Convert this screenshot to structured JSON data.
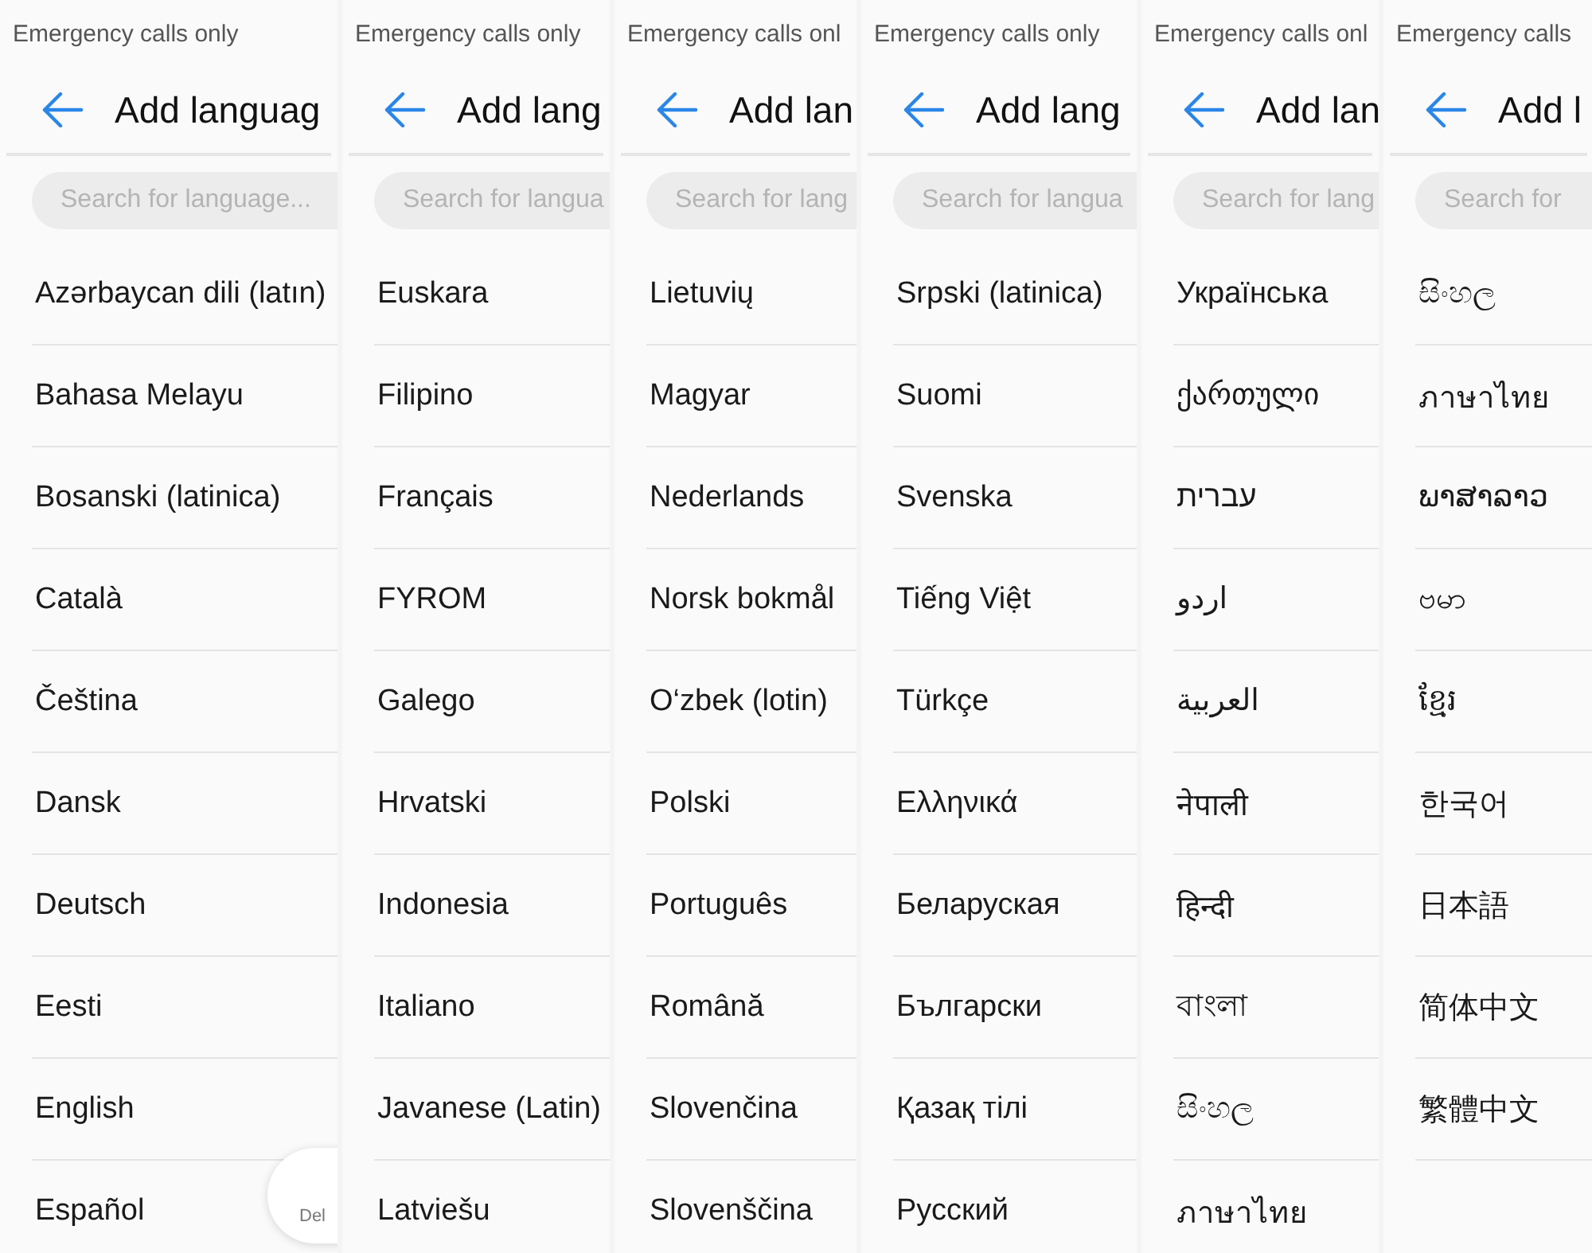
{
  "panels": [
    {
      "status": "Emergency calls only",
      "title": "Add languag",
      "search": {
        "placeholder": "Search for language..."
      },
      "items": [
        "Azərbaycan dili (latın)",
        "Bahasa Melayu",
        "Bosanski (latinica)",
        "Català",
        "Čeština",
        "Dansk",
        "Deutsch",
        "Eesti",
        "English",
        "Español"
      ],
      "delete_button": "Del"
    },
    {
      "status": "Emergency calls only",
      "title": "Add lang",
      "search": {
        "placeholder": "Search for langua"
      },
      "items": [
        "Euskara",
        "Filipino",
        "Français",
        "FYROM",
        "Galego",
        "Hrvatski",
        "Indonesia",
        "Italiano",
        "Javanese (Latin)",
        "Latviešu"
      ]
    },
    {
      "status": "Emergency calls onl",
      "title": "Add lan",
      "search": {
        "placeholder": "Search for lang"
      },
      "items": [
        "Lietuvių",
        "Magyar",
        "Nederlands",
        "Norsk bokmål",
        "O‘zbek (lotin)",
        "Polski",
        "Português",
        "Română",
        "Slovenčina",
        "Slovenščina"
      ]
    },
    {
      "status": "Emergency calls only",
      "title": "Add lang",
      "search": {
        "placeholder": "Search for langua"
      },
      "items": [
        "Srpski (latinica)",
        "Suomi",
        "Svenska",
        "Tiếng Việt",
        "Türkçe",
        "Ελληνικά",
        "Беларуская",
        "Български",
        "Қазақ тілі",
        "Русский"
      ]
    },
    {
      "status": "Emergency calls onl",
      "title": "Add lan",
      "search": {
        "placeholder": "Search for lang"
      },
      "items": [
        "Українська",
        "ქართული",
        "עברית",
        "اردو",
        "العربية",
        "नेपाली",
        "हिन्दी",
        "বাংলা",
        "සිංහල",
        "ภาษาไทย"
      ]
    },
    {
      "status": "Emergency calls",
      "title": "Add l",
      "search": {
        "placeholder": "Search for"
      },
      "items": [
        "සිංහල",
        "ภาษาไทย",
        "ພາສາລາວ",
        "ဗမာ",
        "ខ្មែរ",
        "한국어",
        "日本語",
        "简体中文",
        "繁體中文"
      ]
    }
  ]
}
